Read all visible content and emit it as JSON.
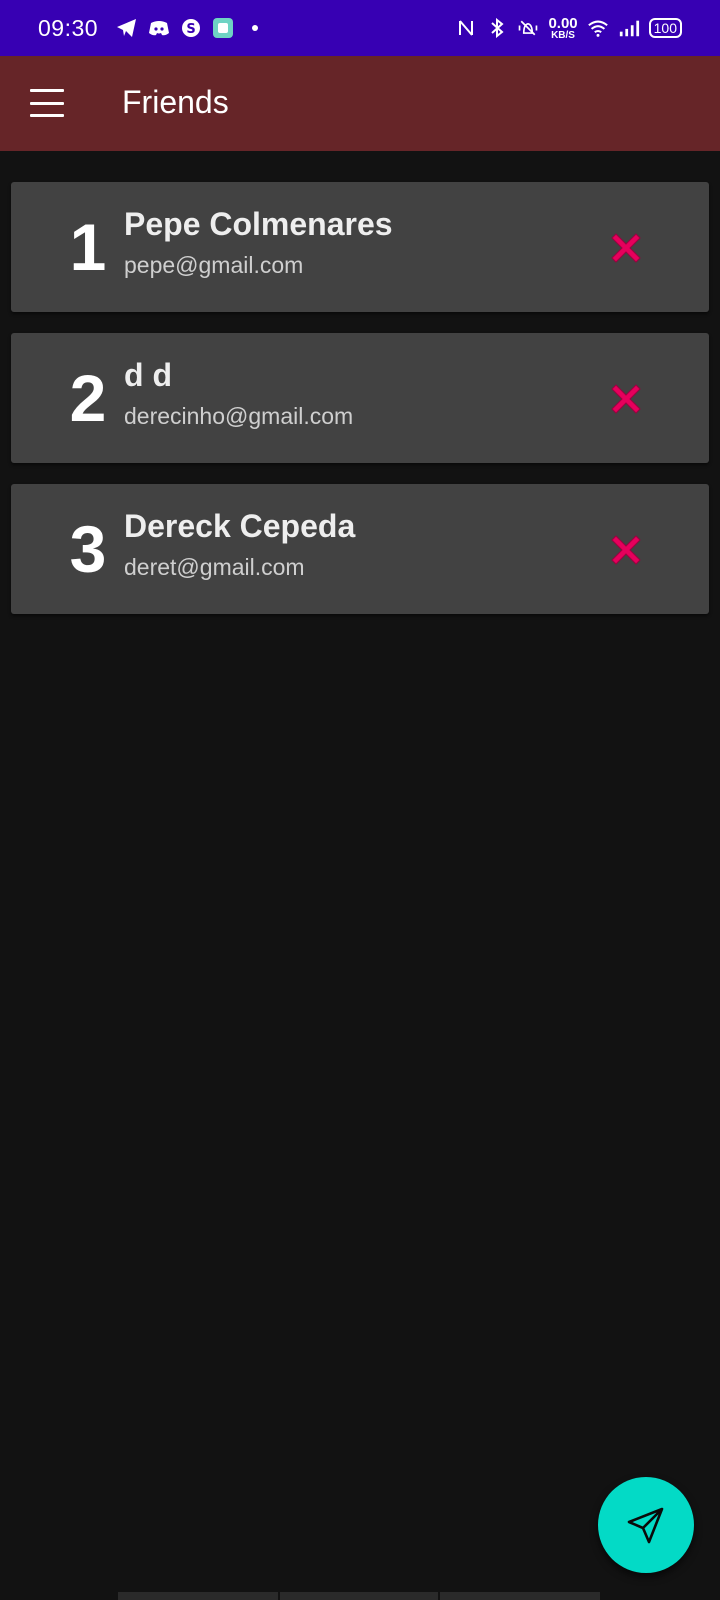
{
  "status_bar": {
    "time": "09:30",
    "net_speed_value": "0.00",
    "net_speed_unit": "KB/S",
    "battery": "100",
    "left_icons": [
      "telegram-icon",
      "discord-icon",
      "skype-icon",
      "app-icon",
      "dot-icon"
    ],
    "right_icons": [
      "nfc-icon",
      "bluetooth-icon",
      "vibrate-icon",
      "wifi-icon",
      "signal-icon",
      "battery-icon"
    ]
  },
  "app_bar": {
    "title": "Friends",
    "menu_icon": "hamburger-menu-icon",
    "background": "#662528"
  },
  "friends": [
    {
      "index": "1",
      "name": "Pepe Colmenares",
      "email": "pepe@gmail.com"
    },
    {
      "index": "2",
      "name": "d d",
      "email": "derecinho@gmail.com"
    },
    {
      "index": "3",
      "name": "Dereck Cepeda",
      "email": "deret@gmail.com"
    }
  ],
  "colors": {
    "status_bar": "#3700b3",
    "card": "#424242",
    "delete": "#e6005c",
    "fab": "#03dac6",
    "background": "#121212"
  },
  "fab": {
    "icon": "send-icon"
  }
}
